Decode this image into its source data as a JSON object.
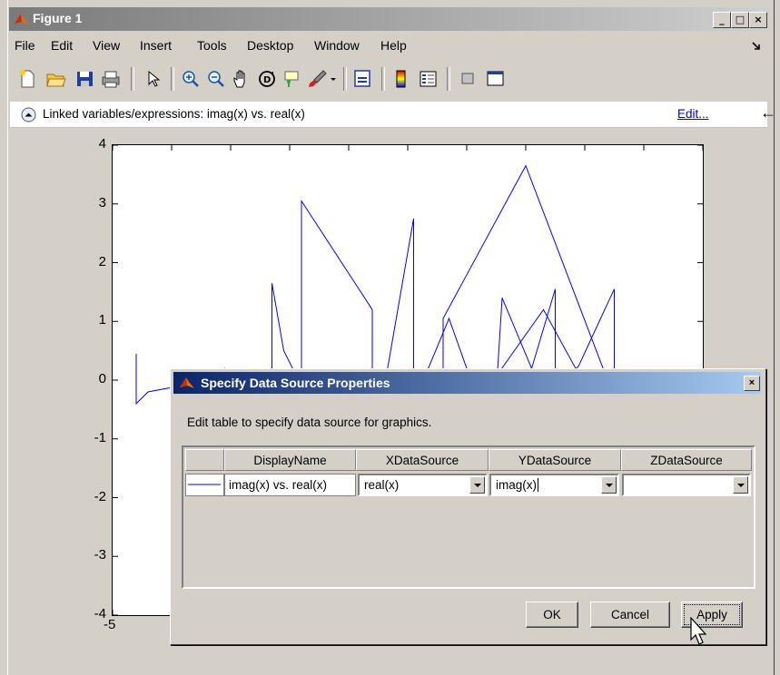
{
  "window": {
    "title": "Figure 1",
    "controls": [
      "_",
      "□",
      "×"
    ]
  },
  "menubar": {
    "items": [
      "File",
      "Edit",
      "View",
      "Insert",
      "Tools",
      "Desktop",
      "Window",
      "Help"
    ],
    "dock_icon": "dock-arrow-icon"
  },
  "toolbar": {
    "icons": [
      "new-figure-icon",
      "open-file-icon",
      "save-icon",
      "print-icon",
      "pointer-icon",
      "zoom-in-icon",
      "zoom-out-icon",
      "pan-hand-icon",
      "rotate-3d-icon",
      "data-cursor-icon",
      "brush-icon",
      "link-plot-icon",
      "colorbar-icon",
      "legend-icon",
      "hide-plot-tools-icon",
      "show-plot-tools-icon"
    ]
  },
  "linkbar": {
    "text": "Linked variables/expressions: imag(x) vs. real(x)",
    "edit_label": "Edit...",
    "back_icon": "left-arrow-icon"
  },
  "chart_data": {
    "type": "line",
    "title": "",
    "xlabel": "",
    "ylabel": "",
    "ylim": [
      -4,
      4
    ],
    "xlim": [
      -5,
      5
    ],
    "y_tick_labels": [
      "4",
      "3",
      "2",
      "1",
      "0",
      "-1",
      "-2",
      "-3",
      "-4"
    ],
    "x_tick_labels": [
      "-5"
    ],
    "color": "#0000ff",
    "series": [
      {
        "x": [
          -4.6,
          -4.6,
          -4.4,
          -2.3,
          -2.3,
          -2.1,
          -1.8,
          -1.8,
          -0.6,
          -0.6,
          0.1,
          0.1,
          0.7,
          1.0,
          1.5,
          1.6,
          2.1,
          2.5,
          2.5,
          2.9,
          3.5,
          3.5,
          2.0,
          0.6,
          0.6,
          1.1,
          2.3,
          2.9,
          2.9,
          -3.4,
          -3.1,
          -2.9
        ],
        "y": [
          0.45,
          -0.4,
          -0.2,
          0.2,
          1.65,
          0.5,
          -0.1,
          3.05,
          1.2,
          -1.3,
          2.75,
          -0.4,
          1.05,
          0.2,
          -0.2,
          1.4,
          0.2,
          1.55,
          -0.2,
          0.25,
          1.55,
          -0.3,
          3.65,
          1.05,
          0.1,
          -0.5,
          1.2,
          0.1,
          -0.6,
          0.0,
          0.2,
          0.1
        ]
      }
    ]
  },
  "dialog": {
    "title": "Specify Data Source Properties",
    "close": "×",
    "instruction": "Edit table to specify data source for graphics.",
    "columns": [
      "DisplayName",
      "XDataSource",
      "YDataSource",
      "ZDataSource"
    ],
    "row": {
      "display_name": "imag(x) vs. real(x)",
      "x_source": "real(x)",
      "y_source": "imag(x)",
      "z_source": ""
    },
    "buttons": {
      "ok": "OK",
      "cancel": "Cancel",
      "apply": "Apply"
    }
  }
}
